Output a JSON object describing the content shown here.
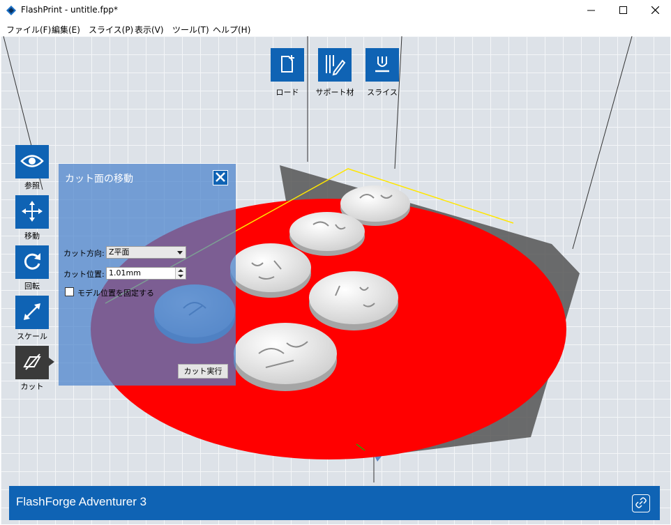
{
  "window": {
    "title": "FlashPrint - untitle.fpp*",
    "minimize_icon": "minimize-icon",
    "maximize_icon": "maximize-icon",
    "close_icon": "close-icon"
  },
  "menu": {
    "items": [
      "ファイル(F)",
      "編集(E)",
      "スライス(P)",
      "表示(V)",
      "ツール(T)",
      "ヘルプ(H)"
    ]
  },
  "top_toolbar": {
    "items": [
      {
        "label": "ロード",
        "icon": "load-file-icon"
      },
      {
        "label": "サポート材",
        "icon": "support-material-icon"
      },
      {
        "label": "スライス",
        "icon": "slice-icon"
      }
    ]
  },
  "side_toolbar": {
    "items": [
      {
        "label": "参照",
        "icon": "eye-icon",
        "active": false
      },
      {
        "label": "移動",
        "icon": "move-arrows-icon",
        "active": false
      },
      {
        "label": "回転",
        "icon": "rotate-icon",
        "active": false
      },
      {
        "label": "スケール",
        "icon": "scale-icon",
        "active": false
      },
      {
        "label": "カット",
        "icon": "cut-icon",
        "active": true
      }
    ]
  },
  "cut_panel": {
    "title": "カット面の移動",
    "direction_label": "カット方向:",
    "direction_value": "Z平面",
    "position_label": "カット位置:",
    "position_value": "1.01mm",
    "fix_checkbox_label": "モデル位置を固定する",
    "fix_checked": false,
    "execute_button": "カット実行"
  },
  "status_bar": {
    "printer_name": "FlashForge Adventurer 3",
    "icon": "connect-link-icon"
  },
  "colors": {
    "accent": "#0f63b4",
    "cut_plane": "#ff0000",
    "panel": "#4a82cc"
  }
}
